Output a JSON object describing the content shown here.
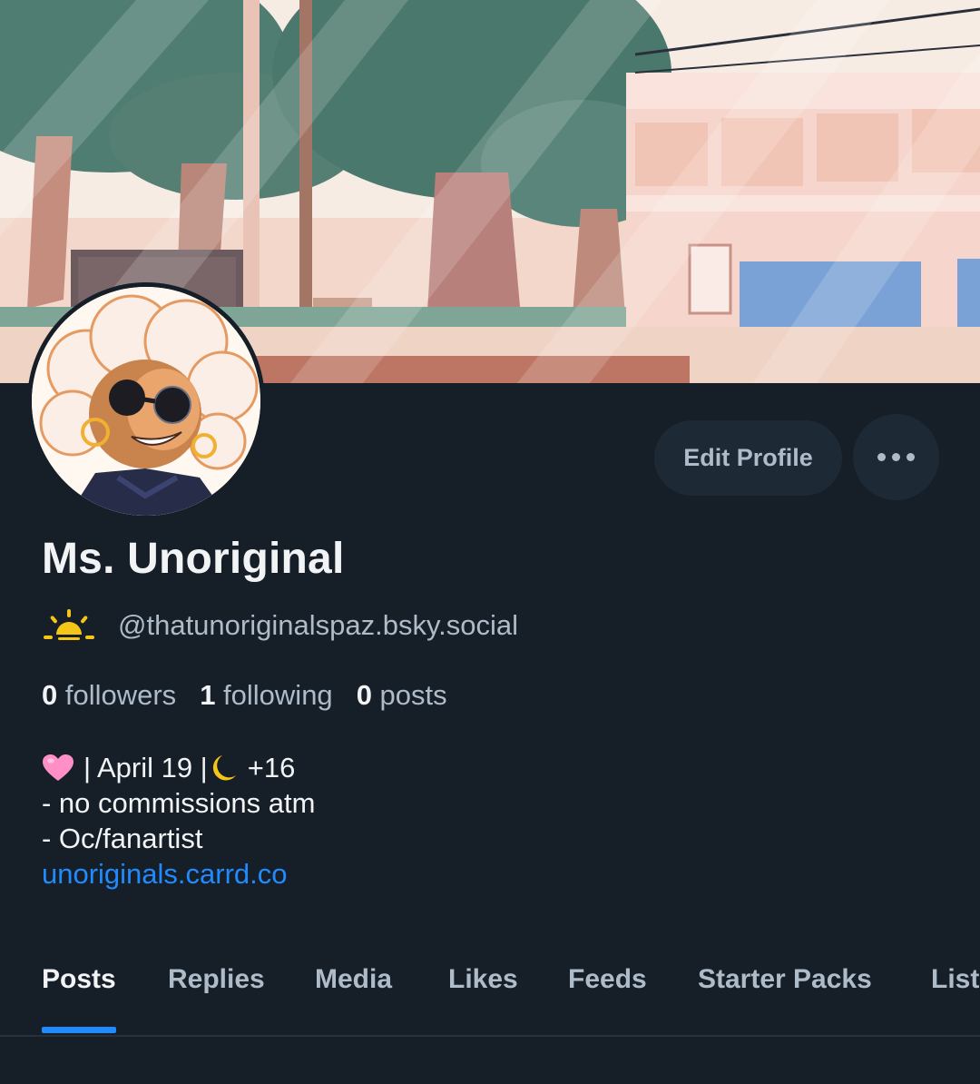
{
  "profile": {
    "display_name": "Ms. Unoriginal",
    "handle": "@thatunoriginalspaz.bsky.social",
    "badge_icon": "sunrise-icon"
  },
  "actions": {
    "edit_label": "Edit Profile",
    "more_icon": "more-dots-icon"
  },
  "stats": {
    "followers_count": "0",
    "followers_label": " followers",
    "following_count": "1",
    "following_label": " following",
    "posts_count": "0",
    "posts_label": " posts"
  },
  "bio": {
    "line1_a": "| April 19 |",
    "line1_b": "+16",
    "line2": "- no commissions atm",
    "line3": "- Oc/fanartist",
    "link": "unoriginals.carrd.co"
  },
  "tabs": [
    {
      "label": "Posts"
    },
    {
      "label": "Replies"
    },
    {
      "label": "Media"
    },
    {
      "label": "Likes"
    },
    {
      "label": "Feeds"
    },
    {
      "label": "Starter Packs"
    },
    {
      "label": "Lists"
    }
  ],
  "colors": {
    "background": "#161e27",
    "accent": "#208bfe",
    "button_bg": "#1e2936",
    "muted_text": "#aebbc9",
    "badge": "#f5c518"
  }
}
